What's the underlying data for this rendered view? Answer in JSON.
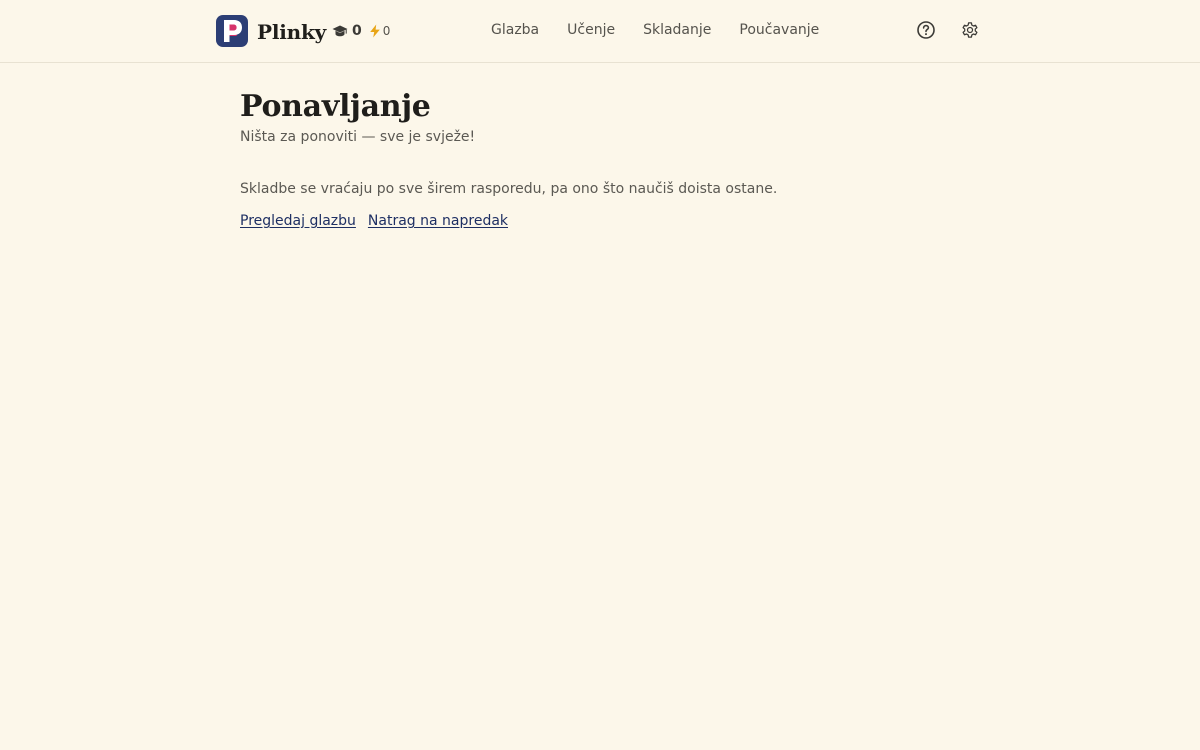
{
  "app": {
    "name": "Plinky",
    "logo_letter": "P"
  },
  "stats": {
    "graduated_icon": "graduation-cap-icon",
    "graduated_count": "0",
    "streak_icon": "lightning-bolt-icon",
    "streak_count": "0"
  },
  "nav": {
    "items": [
      {
        "label": "Glazba"
      },
      {
        "label": "Učenje"
      },
      {
        "label": "Skladanje"
      },
      {
        "label": "Poučavanje"
      }
    ]
  },
  "tools": {
    "help_icon": "question-circle-icon",
    "settings_icon": "gear-icon"
  },
  "page": {
    "title": "Ponavljanje",
    "subtitle": "Ništa za ponoviti — sve je svježe!",
    "explanation": "Skladbe se vraćaju po sve širem rasporedu, pa ono što naučiš doista ostane.",
    "links": {
      "browse_music": "Pregledaj glazbu",
      "back_to_progress": "Natrag na napredak"
    }
  },
  "colors": {
    "background": "#fcf7ea",
    "logo_bg": "#2c3e75",
    "logo_accent": "#d6336c",
    "link": "#1e2f63"
  }
}
